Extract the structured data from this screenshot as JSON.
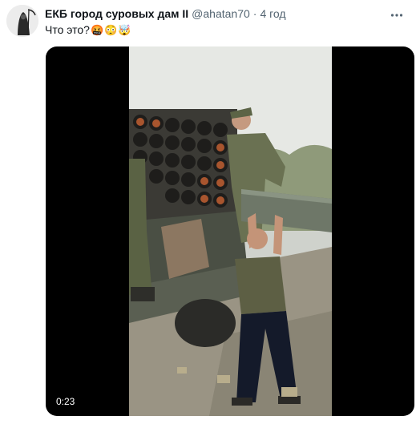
{
  "tweet": {
    "display_name": "ЕКБ город суровых дам II",
    "handle": "@ahatan70",
    "separator": "·",
    "time": "4 год",
    "text": "Что это?",
    "emojis": [
      "🤬",
      "😳",
      "🤯"
    ],
    "icons": {
      "avatar": "grim-reaper-avatar",
      "more": "more-icon"
    }
  },
  "media": {
    "type": "video",
    "duration": "0:23"
  }
}
